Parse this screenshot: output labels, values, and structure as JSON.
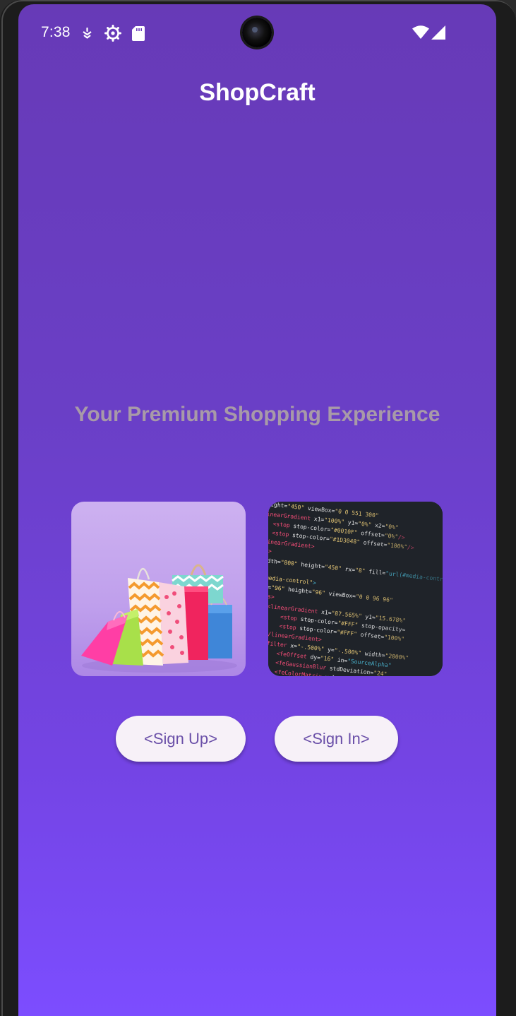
{
  "status_bar": {
    "time": "7:38",
    "left_icons": [
      "notification-icon",
      "settings-gear-icon",
      "sd-card-icon"
    ],
    "right_icons": [
      "wifi-icon",
      "cell-signal-icon"
    ]
  },
  "app_bar": {
    "title": "ShopCraft"
  },
  "hero": {
    "tagline": "Your Premium Shopping Experience"
  },
  "images": {
    "left": "shopping-bags-image",
    "right": "code-screen-image"
  },
  "actions": {
    "sign_up_label": "<Sign Up>",
    "sign_in_label": "<Sign In>"
  },
  "colors": {
    "gradient_top": "#673ab7",
    "gradient_bottom": "#7c4dff",
    "tagline": "#a89aa8",
    "button_bg": "#f7f1f8",
    "button_text": "#6a4fa8"
  }
}
